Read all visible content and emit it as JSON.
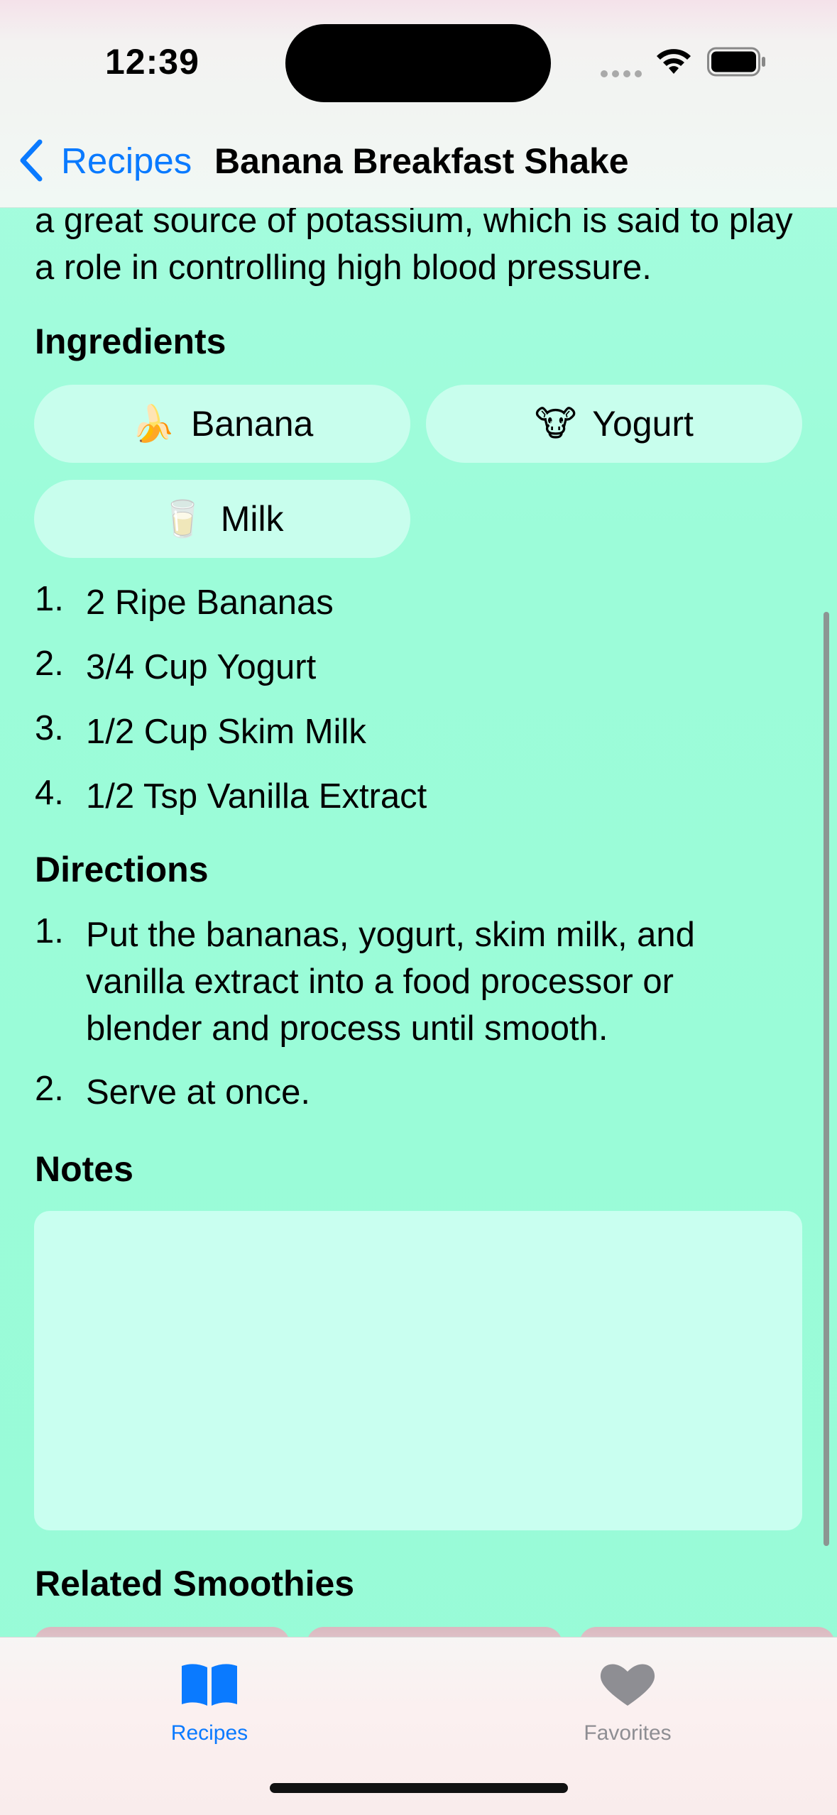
{
  "status": {
    "time": "12:39"
  },
  "nav": {
    "back_label": "Recipes",
    "title": "Banana Breakfast Shake"
  },
  "intro_text": "a great source of potassium, which is said to play a role in controlling high blood pressure.",
  "ingredients": {
    "heading": "Ingredients",
    "chips": [
      {
        "emoji": "🍌",
        "label": "Banana"
      },
      {
        "emoji": "🐮",
        "label": "Yogurt"
      },
      {
        "emoji": "🥛",
        "label": "Milk"
      }
    ],
    "items": [
      {
        "num": "1.",
        "text": "2 Ripe Bananas"
      },
      {
        "num": "2.",
        "text": "3/4 Cup Yogurt"
      },
      {
        "num": "3.",
        "text": "1/2 Cup Skim Milk"
      },
      {
        "num": "4.",
        "text": "1/2 Tsp Vanilla Extract"
      }
    ]
  },
  "directions": {
    "heading": "Directions",
    "items": [
      {
        "num": "1.",
        "text": "Put the bananas, yogurt, skim milk, and vanilla extract into a food processor or blender and process until smooth."
      },
      {
        "num": "2.",
        "text": "Serve at once."
      }
    ]
  },
  "notes": {
    "heading": "Notes",
    "value": ""
  },
  "related": {
    "heading": "Related Smoothies"
  },
  "tabbar": {
    "tabs": [
      {
        "label": "Recipes",
        "icon": "book-icon",
        "active": true
      },
      {
        "label": "Favorites",
        "icon": "heart-icon",
        "active": false
      }
    ],
    "active_color": "#0a7aff",
    "inactive_color": "#8e8e93"
  }
}
